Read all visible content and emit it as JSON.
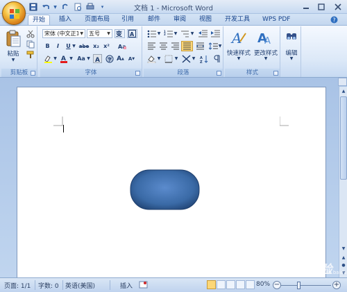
{
  "window": {
    "title": "文档 1 - Microsoft Word"
  },
  "tabs": [
    "开始",
    "插入",
    "页面布局",
    "引用",
    "邮件",
    "审阅",
    "视图",
    "开发工具",
    "WPS PDF"
  ],
  "ribbon": {
    "clipboard": {
      "label": "剪贴板",
      "paste_label": "粘贴"
    },
    "font": {
      "label": "字体",
      "font_name": "宋体 (中文正文)",
      "font_name_display": "宋体 (中文正1",
      "font_size": "五号",
      "bold": "B",
      "italic": "I",
      "underline": "U",
      "strike": "abe",
      "subscript": "x₂",
      "superscript": "x²",
      "change_case": "Aa",
      "grow": "A",
      "shrink": "A"
    },
    "paragraph": {
      "label": "段落"
    },
    "styles": {
      "label": "样式",
      "quick_styles": "快速样式",
      "change_styles": "更改样式"
    },
    "editing": {
      "label": "编辑"
    }
  },
  "document": {
    "shape": "rounded-rectangle",
    "shape_fill": "#3a6aa6"
  },
  "status": {
    "page": "页面: 1/1",
    "words": "字数: 0",
    "language": "英语(美国)",
    "mode": "插入",
    "zoom": "80%"
  },
  "watermark": {
    "text": "Baidu经验",
    "sub": "jingyan.baidu.com"
  }
}
